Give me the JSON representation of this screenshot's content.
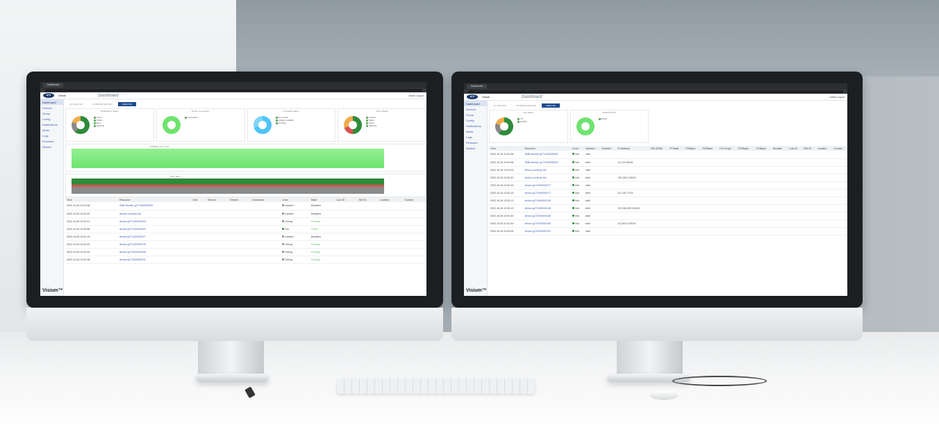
{
  "left_screen": {
    "tab_label": "Dashboard",
    "device_label": "Waste",
    "page_title": "Dashboard",
    "header_right": "Admin  Logout",
    "tabs": [
      "ALL DEVICES",
      "ATX800SH DEVICES",
      "EMEA WK"
    ],
    "subtabs": [
      "OVERVIEW",
      "NETWORKING"
    ],
    "sidebar": [
      "Dashboard",
      "Devices",
      "Group",
      "Config",
      "Notifications",
      "Alerts",
      "Logs",
      "Firmware",
      "System"
    ],
    "brand": "Visium™",
    "panels": [
      {
        "title": "Notifications Status",
        "legend": [
          "Active",
          "Offline",
          "Error",
          "Warning"
        ]
      },
      {
        "title": "Device Connection",
        "legend": [
          "Connected"
        ]
      },
      {
        "title": "Firmware Status",
        "legend": [
          "Up to date",
          "Update Available",
          "Pending"
        ]
      },
      {
        "title": "Alarm Status",
        "legend": [
          "Critical",
          "Major",
          "Minor",
          "Warning"
        ]
      }
    ],
    "chart_titles": [
      "Availability Over Time",
      "Alarms Over Time",
      "Over Time"
    ],
    "table_headers": [
      "Time",
      "Resource",
      "Unit",
      "Service",
      "Stream",
      "Connected",
      "Level",
      "State",
      "Cust ID",
      "Site ID",
      "Location",
      "Contact"
    ],
    "rows": [
      {
        "time": "2022-10-26 12:51:58",
        "resource": "SMB Monitor g2T1000000000",
        "level": "Inactive",
        "state": "Disabled"
      },
      {
        "time": "2022-10-26 12:51:49",
        "resource": "device-cncfxrnjr-f4s",
        "level": "Inactive",
        "state": "Disabled"
      },
      {
        "time": "2022-10-26 12:51:41",
        "resource": "device-g2T1000000018",
        "level": "Debug",
        "state": "Pending"
      },
      {
        "time": "2022-10-26 12:50:58",
        "resource": "device-g2T1000000029",
        "level": "Info",
        "state": "Online"
      },
      {
        "time": "2022-10-26 12:51:15",
        "resource": "device-g2T1000000077",
        "level": "Inactive",
        "state": "Disabled"
      },
      {
        "time": "2022-10-26 12:51:43",
        "resource": "device-g2T1000000139",
        "level": "Debug",
        "state": "Pending"
      },
      {
        "time": "2022-10-26 12:51:49",
        "resource": "device-g2T2000000185",
        "level": "Debug",
        "state": "Pending"
      },
      {
        "time": "2022-10-26 12:51:38",
        "resource": "device-g2T2000000191",
        "level": "Debug",
        "state": "Pending"
      }
    ]
  },
  "right_screen": {
    "tab_label": "Dashboard",
    "device_label": "Waste",
    "page_title": "Dashboard",
    "header_right": "Admin  Logout",
    "tabs": [
      "ALL DEVICES",
      "ATX800SH DEVICES",
      "EMEA WK"
    ],
    "subtabs": [
      "OVERVIEW",
      "NETWORKING"
    ],
    "sidebar": [
      "Dashboard",
      "Devices",
      "Group",
      "Config",
      "Notifications",
      "Alerts",
      "Logs",
      "Firmware",
      "System"
    ],
    "brand": "Visium™",
    "panels": [
      {
        "title": "Link Status",
        "legend": [
          "UP",
          "DOWN"
        ]
      },
      {
        "title": "DHCP/STATIC",
        "legend": [
          "DHCP"
        ]
      }
    ],
    "table_headers": [
      "Time",
      "Resource",
      "Level",
      "Interface",
      "Enabled",
      "IP Address",
      "SW (SDB)",
      "IP Mask",
      "TX/Bytes",
      "RX/Bytes",
      "Per Drops",
      "RX/Bytes",
      "TX/Bytes",
      "Duration",
      "Cust ID",
      "Site ID",
      "Location",
      "Contact"
    ],
    "rows": [
      {
        "time": "2022-10-26 12:51:58",
        "resource": "SMB Monitor g2T1000000000",
        "level": "Info",
        "iface": "nat0",
        "ip": ""
      },
      {
        "time": "2022-10-26 12:51:58",
        "resource": "SMB Monitor g2T1000000000",
        "level": "Info",
        "iface": "eth0",
        "ip": "10.1.51.56/16"
      },
      {
        "time": "2022-10-26 12:52:03",
        "resource": "device-cncfxrnjr-f4s",
        "level": "Info",
        "iface": "nat0",
        "ip": ""
      },
      {
        "time": "2022-10-26 12:52:40",
        "resource": "device-cncfxrnjr-f4s",
        "level": "Info",
        "iface": "eth0",
        "ip": "192.168.1.25/24"
      },
      {
        "time": "2022-10-26 12:52:19",
        "resource": "device-g2T1000000077",
        "level": "Info",
        "iface": "nat0",
        "ip": ""
      },
      {
        "time": "2022-10-26 12:52:19",
        "resource": "device-g2T1000000077",
        "level": "Info",
        "iface": "eth0",
        "ip": "10.1.80.77/24"
      },
      {
        "time": "2022-10-26 12:52:13",
        "resource": "device-g2T1000000139",
        "level": "Info",
        "iface": "nat0",
        "ip": ""
      },
      {
        "time": "2022-10-26 12:52:13",
        "resource": "device-g2T1000000139",
        "level": "Info",
        "iface": "eth0",
        "ip": "192.168.200.104/24"
      },
      {
        "time": "2022-10-26 12:51:49",
        "resource": "device-g2T2000000185",
        "level": "Info",
        "iface": "nat0",
        "ip": ""
      },
      {
        "time": "2022-10-26 12:51:49",
        "resource": "device-g2T2000000185",
        "level": "Info",
        "iface": "eth0",
        "ip": "10.200.0.100/16"
      },
      {
        "time": "2022-10-26 12:52:05",
        "resource": "device-g2T2000000191",
        "level": "Info",
        "iface": "nat0",
        "ip": ""
      }
    ]
  },
  "colors": {
    "brand": "#1b3a6b",
    "accent": "#1b4b8f",
    "green": "#6fe36f",
    "link": "#3a5db8"
  }
}
